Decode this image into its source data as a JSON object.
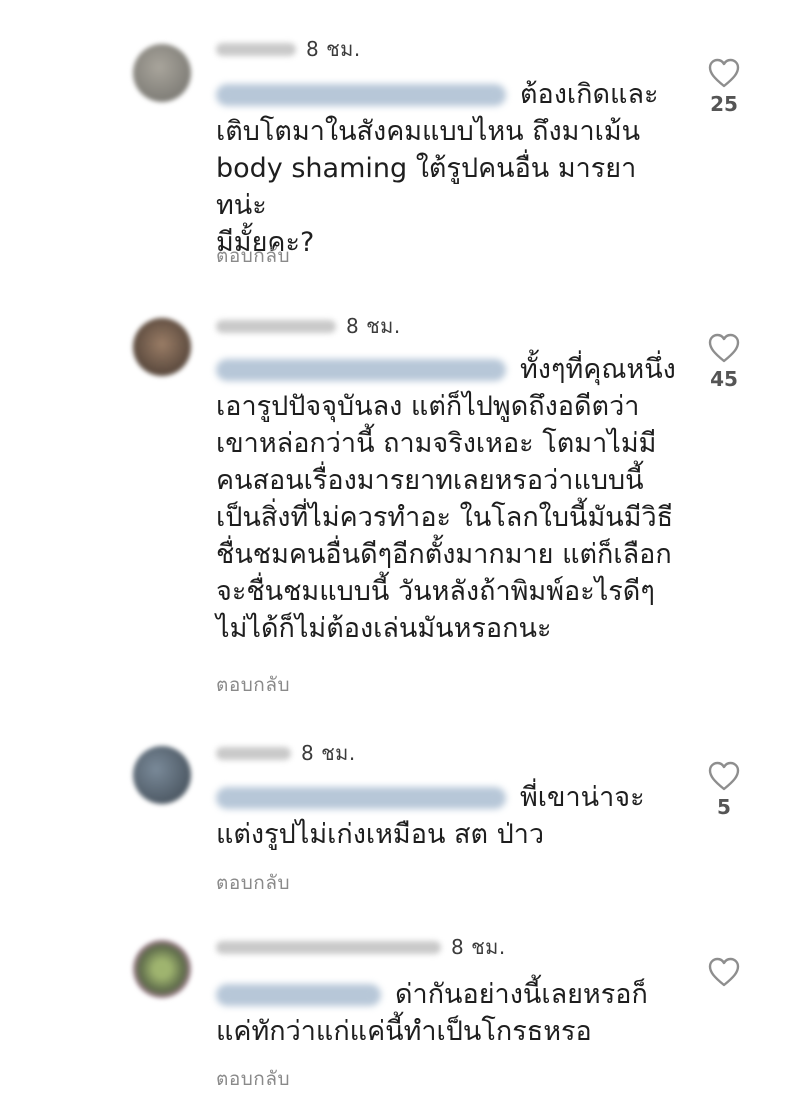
{
  "comments": [
    {
      "time": "8 ชม.",
      "lines": [
        "ต้องเกิดและ",
        "เติบโตมาในสังคมแบบไหน ถึงมาเม้น",
        "body shaming ใต้รูปคนอื่น มารยาทน่ะ",
        "มีมั้ยคะ?"
      ],
      "reply": "ตอบกลับ",
      "likes": "25",
      "avatar_color": "#8a8a84"
    },
    {
      "time": "8 ชม.",
      "lines": [
        "ทั้งๆที่คุณหนึ่ง",
        "เอารูปปัจจุบันลง แต่ก็ไปพูดถึงอดีตว่า",
        "เขาหล่อกว่านี้ ถามจริงเหอะ โตมาไม่มี",
        "คนสอนเรื่องมารยาทเลยหรอว่าแบบนี้",
        "เป็นสิ่งที่ไม่ควรทำอะ ในโลกใบนี้มันมีวิธี",
        "ชื่นชมคนอื่นดีๆอีกตั้งมากมาย แต่ก็เลือก",
        "จะชื่นชมแบบนี้ วันหลังถ้าพิมพ์อะไรดีๆ",
        "ไม่ได้ก็ไม่ต้องเล่นมันหรอกนะ"
      ],
      "reply": "ตอบกลับ",
      "likes": "45",
      "avatar_color": "#6b5a4e"
    },
    {
      "time": "8 ชม.",
      "lines": [
        "พี่เขาน่าจะ",
        "แต่งรูปไม่เก่งเหมือน สต ป่าว"
      ],
      "reply": "ตอบกลับ",
      "likes": "5",
      "avatar_color": "#4f5a66"
    },
    {
      "time": "8 ชม.",
      "lines": [
        "ด่ากันอย่างนี้เลยหรอก็",
        "แค่ทักว่าแก่แค่นี้ทำเป็นโกรธหรอ"
      ],
      "reply": "ตอบกลับ",
      "likes": "",
      "avatar_color": "#7b8f62"
    }
  ],
  "icons": {
    "like": "heart-outline-icon"
  }
}
